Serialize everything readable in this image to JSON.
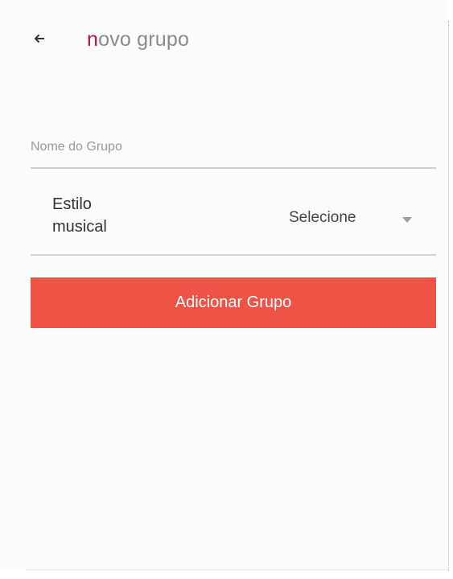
{
  "app_bar": {
    "back_icon": "arrow-left-icon",
    "title_accent": "n",
    "title_rest": "ovo grupo",
    "accent_color": "#b3172f"
  },
  "form": {
    "group_name": {
      "placeholder": "Nome do Grupo",
      "value": ""
    },
    "music_style": {
      "label": "Estilo\nmusical",
      "selected_value": "Selecione",
      "dropdown_icon": "caret-down-icon"
    },
    "submit": {
      "label": "Adicionar Grupo",
      "background_color": "#ef5346"
    }
  }
}
